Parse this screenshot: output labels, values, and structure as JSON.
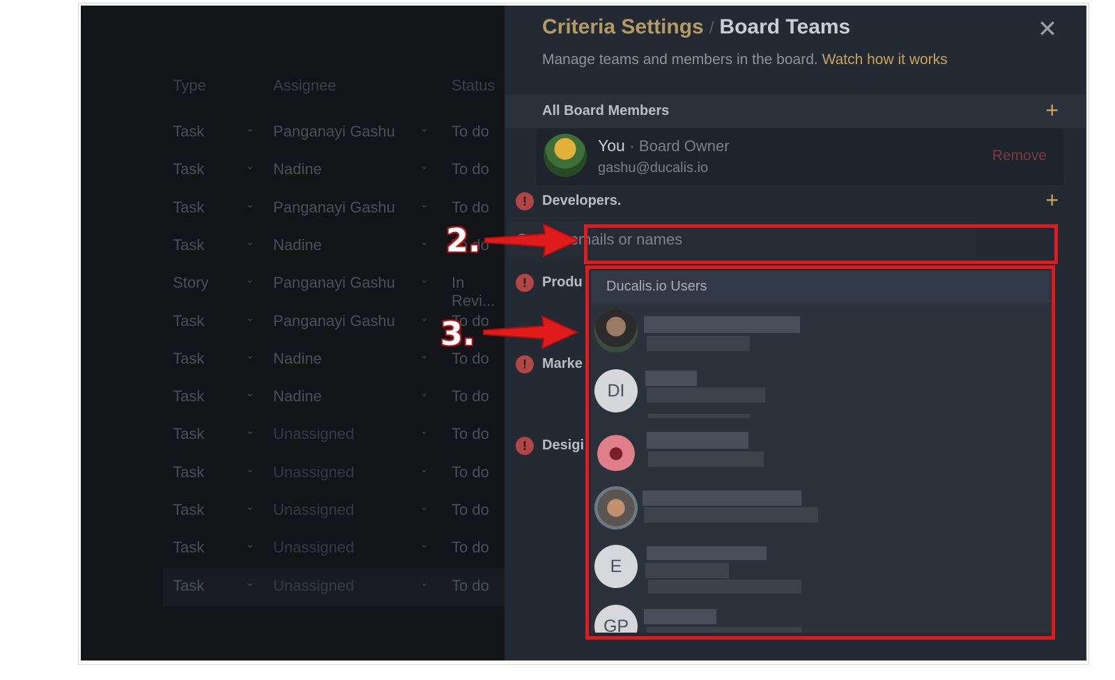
{
  "background_table": {
    "headers": {
      "type": "Type",
      "assignee": "Assignee",
      "status": "Status"
    },
    "rows": [
      {
        "type": "Task",
        "assignee": "Panganayi Gashu",
        "status": "To do"
      },
      {
        "type": "Task",
        "assignee": "Nadine",
        "status": "To do"
      },
      {
        "type": "Task",
        "assignee": "Panganayi Gashu",
        "status": "To do"
      },
      {
        "type": "Task",
        "assignee": "Nadine",
        "status": "To do"
      },
      {
        "type": "Story",
        "assignee": "Panganayi Gashu",
        "status": "In Revi..."
      },
      {
        "type": "Task",
        "assignee": "Panganayi Gashu",
        "status": "To do"
      },
      {
        "type": "Task",
        "assignee": "Nadine",
        "status": "To do"
      },
      {
        "type": "Task",
        "assignee": "Nadine",
        "status": "To do"
      },
      {
        "type": "Task",
        "assignee": "Unassigned",
        "status": "To do"
      },
      {
        "type": "Task",
        "assignee": "Unassigned",
        "status": "To do"
      },
      {
        "type": "Task",
        "assignee": "Unassigned",
        "status": "To do"
      },
      {
        "type": "Task",
        "assignee": "Unassigned",
        "status": "To do"
      },
      {
        "type": "Task",
        "assignee": "Unassigned",
        "status": "To do"
      }
    ]
  },
  "panel": {
    "breadcrumb_parent": "Criteria Settings",
    "breadcrumb_separator": "/",
    "title": "Board Teams",
    "close_icon": "close-icon",
    "subtitle": "Manage teams and members in the board.",
    "subtitle_link": "Watch how it works",
    "all_members": {
      "label": "All Board Members",
      "add_icon": "plus-icon",
      "owner": {
        "name": "You",
        "separator": "·",
        "role": "Board Owner",
        "email": "gashu@ducalis.io",
        "remove_label": "Remove"
      }
    },
    "teams": [
      {
        "label": "Developers.",
        "warning": "!"
      },
      {
        "label": "Produ",
        "warning": "!"
      },
      {
        "label": "Marke",
        "warning": "!"
      },
      {
        "label": "Desigi",
        "warning": "!"
      }
    ],
    "add_icon": "+"
  },
  "search": {
    "placeholder": "Search emails or names",
    "value": ""
  },
  "dropdown": {
    "header": "Ducalis.io Users",
    "users": [
      {
        "avatar": "photo"
      },
      {
        "avatar": "DI"
      },
      {
        "avatar": "photo"
      },
      {
        "avatar": "photo"
      },
      {
        "avatar": "E"
      },
      {
        "avatar": "GP"
      }
    ]
  },
  "annotations": {
    "step2": "2.",
    "step3": "3."
  },
  "colors": {
    "accent": "#c8a45a",
    "highlight": "#e01b1b",
    "warning": "#b14646"
  }
}
